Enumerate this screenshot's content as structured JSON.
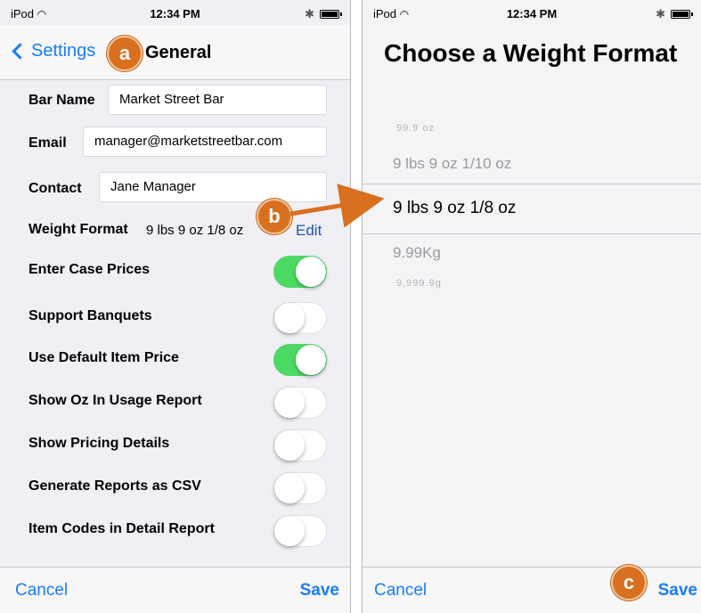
{
  "left": {
    "status": {
      "carrier": "iPod",
      "time": "12:34 PM"
    },
    "nav": {
      "back_label": "Settings",
      "title": "General"
    },
    "badge_a": "a",
    "fields": {
      "bar_name": {
        "label": "Bar Name",
        "value": "Market Street Bar"
      },
      "email": {
        "label": "Email",
        "value": "manager@marketstreetbar.com"
      },
      "contact": {
        "label": "Contact",
        "value": "Jane Manager"
      },
      "weight_format": {
        "label": "Weight Format",
        "value": "9 lbs 9 oz 1/8 oz",
        "edit_label": "Edit"
      }
    },
    "toggles": [
      {
        "label": "Enter Case Prices",
        "on": true
      },
      {
        "label": "Support Banquets",
        "on": false
      },
      {
        "label": "Use Default Item Price",
        "on": true
      },
      {
        "label": "Show Oz In Usage Report",
        "on": false
      },
      {
        "label": "Show Pricing Details",
        "on": false
      },
      {
        "label": "Generate Reports as CSV",
        "on": false
      },
      {
        "label": "Item Codes in Detail Report",
        "on": false
      }
    ],
    "toolbar": {
      "cancel": "Cancel",
      "save": "Save"
    }
  },
  "badge_b": "b",
  "right": {
    "status": {
      "carrier": "iPod",
      "time": "12:34 PM"
    },
    "title": "Choose a Weight Format",
    "options": [
      "99.9 oz",
      "9 lbs 9 oz 1/10 oz",
      "9 lbs 9 oz 1/8 oz",
      "9.99Kg",
      "9,999.9g"
    ],
    "selected_index": 2,
    "toolbar": {
      "cancel": "Cancel",
      "save": "Save"
    },
    "badge_c": "c"
  },
  "colors": {
    "ios_blue": "#1a7cf6",
    "edit_blue": "#1a56b9",
    "switch_on": "#4cd964",
    "callout_orange": "#d9701f",
    "arrow_orange": "#d9701f"
  }
}
